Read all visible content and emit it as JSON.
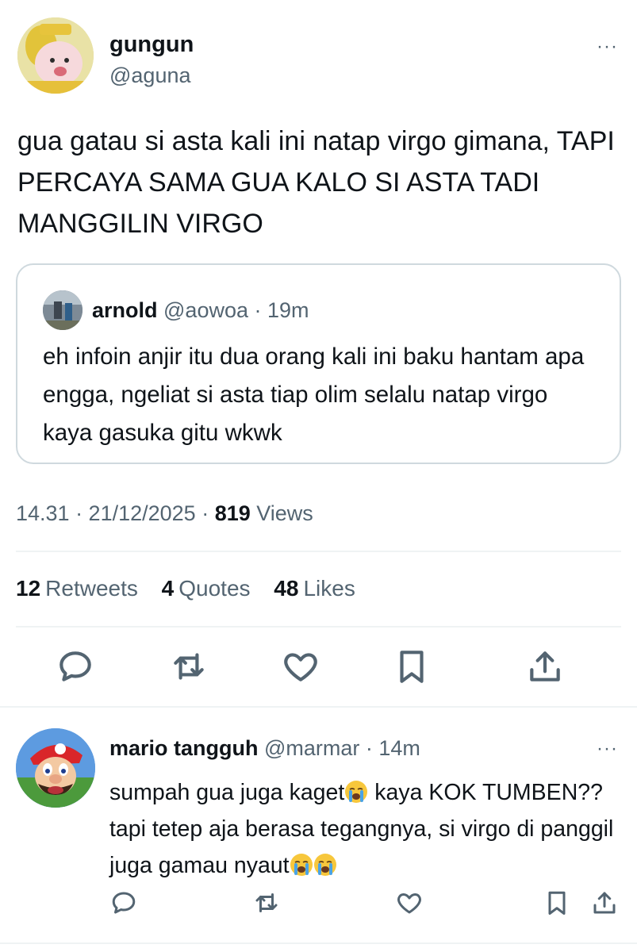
{
  "main_tweet": {
    "author_name": "gungun",
    "author_handle": "@aguna",
    "more_label": "···",
    "text": "gua gatau si asta kali ini natap virgo gimana, TAPI PERCAYA SAMA GUA KALO SI ASTA TADI MANGGILIN VIRGO",
    "time_date": "14.31 · 21/12/2025 · ",
    "views_count": "819",
    "views_label": " Views",
    "stats": {
      "retweets_count": "12",
      "retweets_label": "Retweets",
      "quotes_count": "4",
      "quotes_label": "Quotes",
      "likes_count": "48",
      "likes_label": "Likes"
    }
  },
  "quoted_tweet": {
    "author_name": "arnold",
    "meta": " @aowoa · 19m",
    "text": "eh infoin anjir itu dua orang kali ini baku hantam apa engga, ngeliat si asta tiap olim selalu natap virgo kaya gasuka gitu wkwk"
  },
  "reply": {
    "author_name": "mario tangguh",
    "meta": " @marmar · 14m",
    "more_label": "···",
    "text_part1": "sumpah gua juga kaget",
    "text_part2": " kaya KOK TUMBEN?? tapi tetep aja berasa tegangnya, si virgo di panggil juga gamau nyaut",
    "emoji_name": "loudly-crying-face-emoji"
  },
  "icons": {
    "reply": "reply-icon",
    "retweet": "retweet-icon",
    "like": "heart-icon",
    "bookmark": "bookmark-icon",
    "share": "share-icon"
  },
  "colors": {
    "text_primary": "#0f1419",
    "text_secondary": "#536471",
    "border": "#cfd9de",
    "divider": "#eff3f4"
  }
}
